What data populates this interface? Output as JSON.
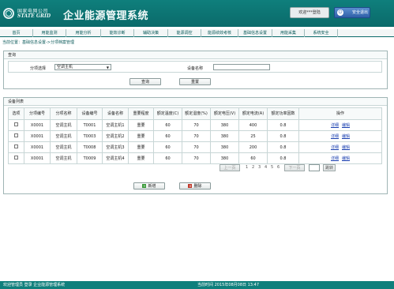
{
  "header": {
    "logo_cn": "国家电网公司",
    "logo_en": "STATE GRID",
    "title": "企业能源管理系统",
    "welcome": "欢迎***登陆",
    "logout": "安全退出"
  },
  "nav": [
    "首页",
    "用能监测",
    "用能分析",
    "能效诊断",
    "辅助决策",
    "能源调控",
    "能源绩效考核",
    "基础信息设置",
    "用能采集",
    "系统安全"
  ],
  "breadcrumb": "当前位置：基础信息设置->分项档案管理",
  "query": {
    "title": "查询",
    "category_label": "分项选择",
    "category_value": "空调主机",
    "device_label": "设备名称",
    "device_value": "",
    "search_btn": "查询",
    "reset_btn": "重置"
  },
  "list": {
    "title": "设备列表",
    "columns": [
      "选项",
      "分项编号",
      "分项名称",
      "设备编号",
      "设备名称",
      "重要程度",
      "额定温度(C)",
      "额定湿度(%)",
      "额定电压(V)",
      "额定电流(A)",
      "额定功率因数",
      "操作"
    ],
    "rows": [
      [
        "X0001",
        "空调主机",
        "T0001",
        "空调主机1",
        "重要",
        "60",
        "70",
        "380",
        "400",
        "0.8"
      ],
      [
        "X0001",
        "空调主机",
        "T0003",
        "空调主机2",
        "重要",
        "60",
        "70",
        "380",
        "25",
        "0.8"
      ],
      [
        "X0001",
        "空调主机",
        "T0008",
        "空调主机3",
        "重要",
        "60",
        "70",
        "380",
        "200",
        "0.8"
      ],
      [
        "X0001",
        "空调主机",
        "T0009",
        "空调主机4",
        "重要",
        "60",
        "70",
        "380",
        "60",
        "0.8"
      ]
    ],
    "detail_link": "详细",
    "edit_link": "编辑"
  },
  "pager": {
    "prev": "上一页",
    "pages": [
      "1",
      "2",
      "3",
      "4",
      "5",
      "6"
    ],
    "next": "下一页",
    "jump": "跳转"
  },
  "actions": {
    "add": "新增",
    "delete": "删除"
  },
  "footer": {
    "left": "欢迎管理员 登录 企业能源管理系统",
    "right": "当前时间 2015年08月08日 13:47"
  }
}
